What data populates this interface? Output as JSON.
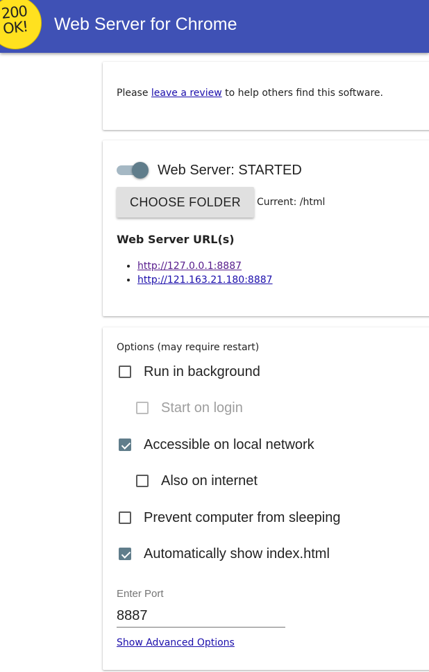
{
  "header": {
    "logo_text": "200\nOK!",
    "title": "Web Server for Chrome"
  },
  "review_card": {
    "prefix": "Please ",
    "link": "leave a review",
    "suffix": " to help others find this software."
  },
  "server_card": {
    "status": "Web Server: STARTED",
    "toggle_on": true,
    "choose_folder": "CHOOSE FOLDER",
    "current_folder": "Current: /html",
    "urls_heading": "Web Server URL(s)",
    "urls": [
      "http://127.0.0.1:8887",
      "http://121.163.21.180:8887"
    ]
  },
  "options_card": {
    "heading": "Options (may require restart)",
    "options": [
      {
        "label": "Run in background",
        "checked": false,
        "disabled": false
      },
      {
        "label": "Start on login",
        "checked": false,
        "disabled": true
      },
      {
        "label": "Accessible on local network",
        "checked": true,
        "disabled": false
      },
      {
        "label": "Also on internet",
        "checked": false,
        "disabled": false
      },
      {
        "label": "Prevent computer from sleeping",
        "checked": false,
        "disabled": false
      },
      {
        "label": "Automatically show index.html",
        "checked": true,
        "disabled": false
      }
    ],
    "port_label": "Enter Port",
    "port_value": "8887",
    "advanced_link": "Show Advanced Options"
  },
  "colors": {
    "appbar": "#3f51b5",
    "accent": "#607d8b",
    "logo": "#ffe11f"
  }
}
